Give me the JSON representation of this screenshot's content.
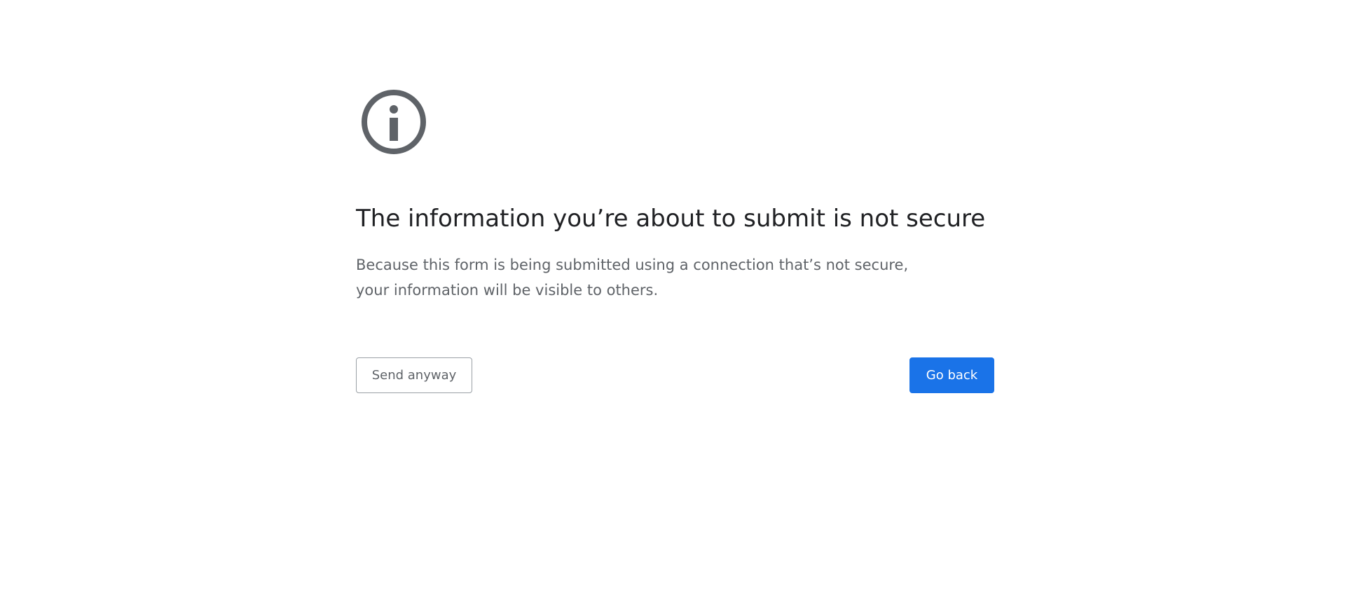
{
  "interstitial": {
    "icon": "info-circle-icon",
    "heading": "The information you’re about to submit is not secure",
    "message": "Because this form is being submitted using a connection that’s not secure, your information will be visible to others.",
    "secondary_button_label": "Send anyway",
    "primary_button_label": "Go back"
  },
  "colors": {
    "primary_button_bg": "#1a73e8",
    "heading_text": "#202124",
    "body_text": "#5f6368",
    "icon": "#5f6368",
    "secondary_button_border": "#9aa0a6"
  }
}
